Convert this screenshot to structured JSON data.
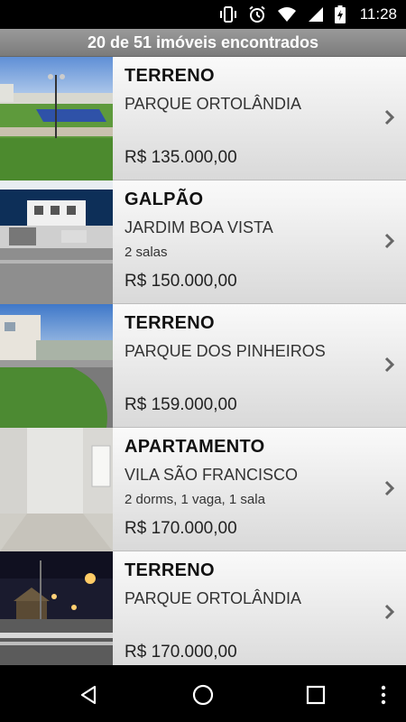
{
  "status_bar": {
    "time": "11:28",
    "icons": [
      "vibrate-icon",
      "alarm-icon",
      "wifi-icon",
      "signal-icon",
      "battery-icon"
    ]
  },
  "header": {
    "title": "20 de 51 imóveis encontrados"
  },
  "listings": [
    {
      "type": "TERRENO",
      "neighborhood": "PARQUE ORTOLÂNDIA",
      "details": "",
      "price": "R$ 135.000,00"
    },
    {
      "type": "GALPÃO",
      "neighborhood": "JARDIM BOA VISTA",
      "details": "2 salas",
      "price": "R$ 150.000,00"
    },
    {
      "type": "TERRENO",
      "neighborhood": "PARQUE DOS PINHEIROS",
      "details": "",
      "price": "R$ 159.000,00"
    },
    {
      "type": "APARTAMENTO",
      "neighborhood": "VILA SÃO FRANCISCO",
      "details": "2 dorms, 1 vaga, 1 sala",
      "price": "R$ 170.000,00"
    },
    {
      "type": "TERRENO",
      "neighborhood": "PARQUE ORTOLÂNDIA",
      "details": "",
      "price": "R$ 170.000,00"
    }
  ],
  "nav": {
    "icons": [
      "back-icon",
      "home-icon",
      "recents-icon",
      "overflow-menu-icon"
    ]
  }
}
